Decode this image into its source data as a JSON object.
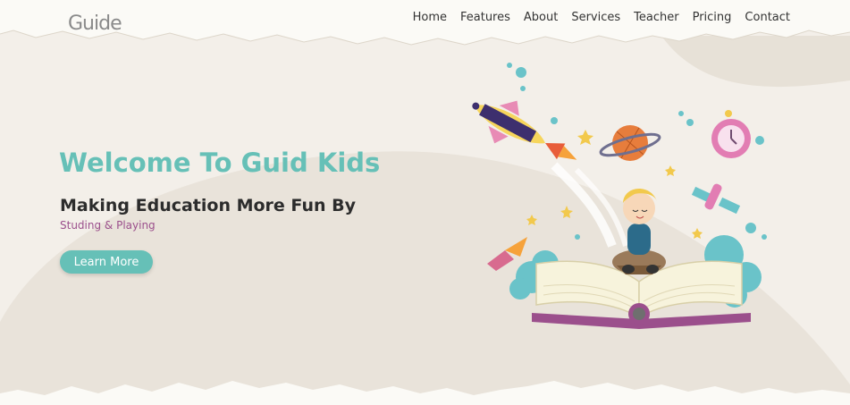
{
  "brand": {
    "logo_text": "Guide"
  },
  "nav": {
    "items": [
      "Home",
      "Features",
      "About",
      "Services",
      "Teacher",
      "Pricing",
      "Contact"
    ]
  },
  "hero": {
    "title": "Welcome To Guid Kids",
    "subtitle": "Making Education More Fun By",
    "tagline": "Studing & Playing",
    "cta_label": "Learn More"
  },
  "colors": {
    "accent": "#66c0b7",
    "tagline": "#9b4f8c",
    "background": "#f3efe9",
    "blob": "#e9e3da"
  },
  "illustration": {
    "subject": "kid-reading-book-with-rocket-and-planets"
  }
}
